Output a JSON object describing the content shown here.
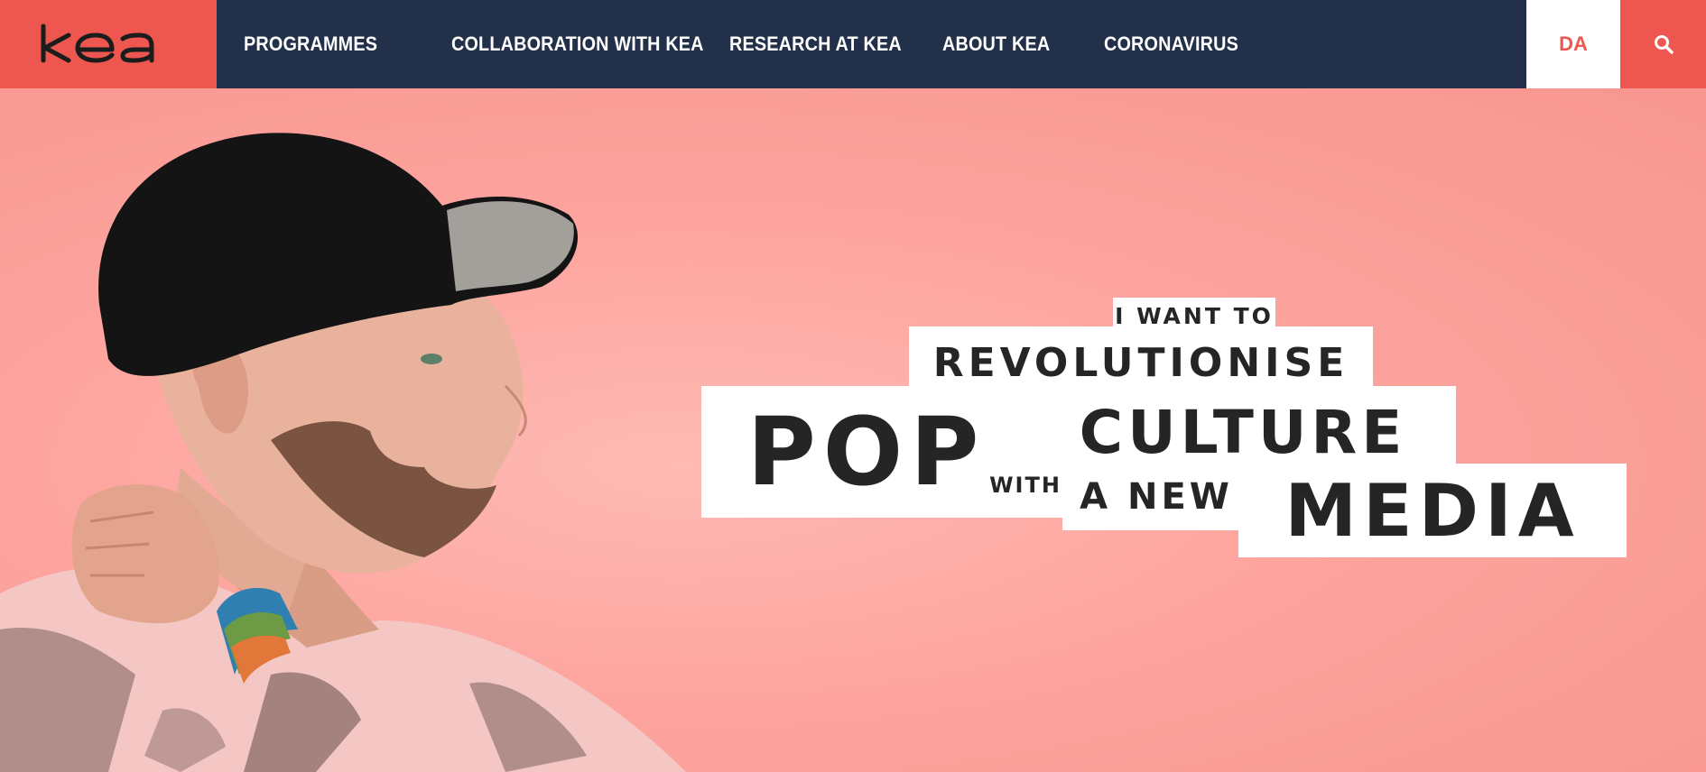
{
  "header": {
    "logo_text": "kea",
    "nav": [
      {
        "label": "PROGRAMMES"
      },
      {
        "label": "COLLABORATION WITH KEA"
      },
      {
        "label": "RESEARCH AT KEA"
      },
      {
        "label": "ABOUT KEA"
      },
      {
        "label": "CORONAVIRUS"
      }
    ],
    "language": "DA",
    "search_icon": "search-icon"
  },
  "hero": {
    "line1": "I WANT TO",
    "line2": "REVOLUTIONISE",
    "line3a": "POP",
    "line3b": "CULTURE",
    "line4a": "WITH",
    "line4b": "A NEW",
    "line4c": "MEDIA"
  },
  "colors": {
    "brand_red": "#ed574f",
    "nav_navy": "#23304a",
    "hero_pink": "#fda49e",
    "headline_text": "#252525"
  }
}
